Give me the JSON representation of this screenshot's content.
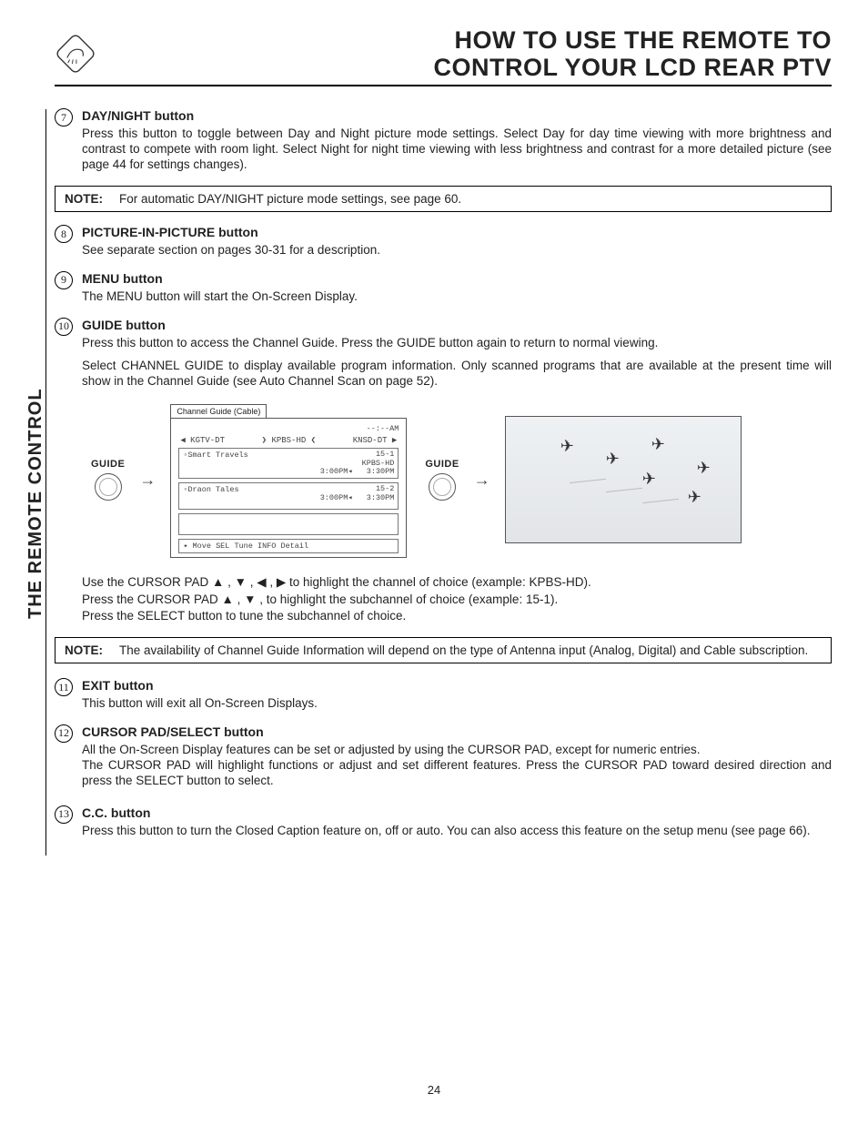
{
  "header": {
    "title_line1": "HOW TO USE THE REMOTE TO",
    "title_line2": "CONTROL YOUR LCD REAR PTV"
  },
  "sidebar": {
    "label": "THE REMOTE CONTROL"
  },
  "sections": {
    "s7": {
      "num": "7",
      "title": "DAY/NIGHT button",
      "body": "Press this button to toggle between Day and Night picture mode settings.  Select Day for day time viewing with more brightness and contrast to compete with room light.  Select Night for night time viewing with less brightness and contrast for a more detailed picture (see page 44 for settings changes)."
    },
    "note1": {
      "label": "NOTE:",
      "text": "For automatic DAY/NIGHT picture mode settings, see page 60."
    },
    "s8": {
      "num": "8",
      "title": "PICTURE-IN-PICTURE button",
      "body": "See separate section on pages 30-31 for a description."
    },
    "s9": {
      "num": "9",
      "title": "MENU button",
      "body": "The MENU button will start the On-Screen Display."
    },
    "s10": {
      "num": "10",
      "title": "GUIDE button",
      "body1": "Press this button to access the Channel Guide.  Press the GUIDE button again to return to normal viewing.",
      "body2": "Select CHANNEL GUIDE to display available program information.  Only scanned programs that are available at the present time will show in the Channel Guide (see Auto Channel Scan on page 52)."
    },
    "guide_label": "GUIDE",
    "osd": {
      "tab": "Channel Guide (Cable)",
      "time": "--:--AM",
      "ch_left": "KGTV-DT",
      "ch_mid": "KPBS-HD",
      "ch_right": "KNSD-DT",
      "row1_title": "Smart Travels",
      "row1_sub": "KPBS-HD",
      "row1_ch": "15-1",
      "row1_t1": "3:00PM",
      "row1_t2": "3:30PM",
      "row2_title": "Draon Tales",
      "row2_ch": "15-2",
      "row2_t1": "3:00PM",
      "row2_t2": "3:30PM",
      "footer": "✦ Move  SEL Tune  INFO Detail"
    },
    "cursor": {
      "l1": "Use the CURSOR PAD ▲ , ▼ , ◀ , ▶ to highlight the channel of choice (example: KPBS-HD).",
      "l2": "Press  the CURSOR PAD ▲ , ▼ , to highlight the subchannel of choice (example: 15-1).",
      "l3": "Press the SELECT button to tune the subchannel of choice."
    },
    "note2": {
      "label": "NOTE:",
      "text": "The availability of Channel Guide Information will depend on the type of Antenna input (Analog, Digital) and Cable subscription."
    },
    "s11": {
      "num": "11",
      "title": "EXIT button",
      "body": "This button will exit all On-Screen Displays."
    },
    "s12": {
      "num": "12",
      "title": "CURSOR PAD/SELECT button",
      "body": "All the On-Screen Display features can be set or adjusted by using the CURSOR PAD, except for numeric entries.\nThe CURSOR PAD will highlight functions or adjust and set different features.  Press the CURSOR PAD toward desired direction and press the SELECT button to select."
    },
    "s13": {
      "num": "13",
      "title": "C.C. button",
      "body": "Press this button to turn the Closed Caption feature on, off or auto.  You can also access this feature on the setup menu (see page 66)."
    }
  },
  "page_number": "24"
}
